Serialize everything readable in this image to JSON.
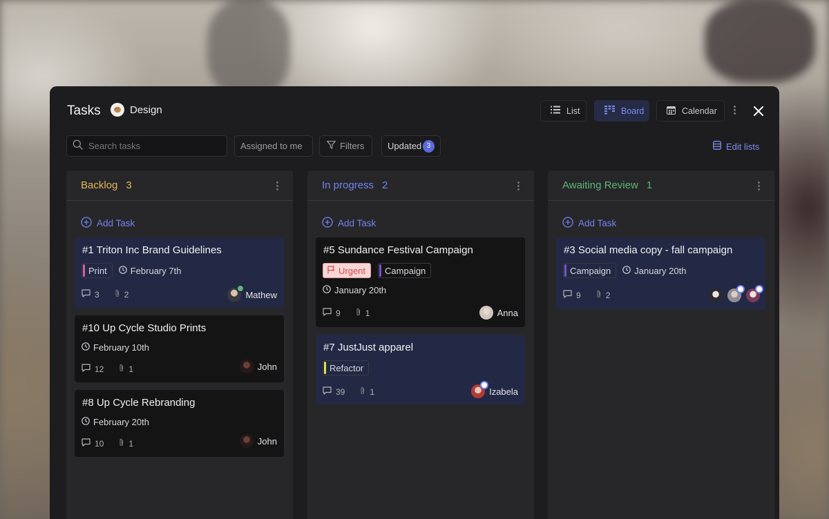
{
  "header": {
    "title": "Tasks",
    "project": "Design",
    "views": [
      {
        "label": "List",
        "icon": "list-icon"
      },
      {
        "label": "Board",
        "icon": "board-icon"
      },
      {
        "label": "Calendar",
        "icon": "calendar-icon"
      }
    ],
    "active_view": "Board"
  },
  "toolbar": {
    "search_placeholder": "Search tasks",
    "assigned_label": "Assigned to me",
    "filters_label": "Filters",
    "updated_label": "Updated",
    "updated_count": "3",
    "edit_lists_label": "Edit lists"
  },
  "colors": {
    "backlog": "#e6b65a",
    "in_progress": "#7383ee",
    "awaiting_review": "#5fb57b",
    "accent": "#7383ee"
  },
  "columns": [
    {
      "name": "Backlog",
      "count": "3",
      "add_label": "Add Task",
      "cards": [
        {
          "title": "#1  Triton Inc Brand Guidelines",
          "tag": "Print",
          "date": "February 7th",
          "comments": "3",
          "attachments": "2",
          "assignee": "Mathew"
        },
        {
          "title": "#10  Up Cycle Studio Prints",
          "date": "February 10th",
          "comments": "12",
          "attachments": "1",
          "assignee": "John"
        },
        {
          "title": "#8  Up Cycle Rebranding",
          "date": "February 20th",
          "comments": "10",
          "attachments": "1",
          "assignee": "John"
        }
      ]
    },
    {
      "name": "In progress",
      "count": "2",
      "add_label": "Add Task",
      "cards": [
        {
          "title": "#5  Sundance Festival Campaign",
          "priority": "Urgent",
          "tag": "Campaign",
          "date": "January 20th",
          "comments": "9",
          "attachments": "1",
          "assignee": "Anna"
        },
        {
          "title": "#7  JustJust apparel",
          "tag": "Refactor",
          "comments": "39",
          "attachments": "1",
          "assignee": "Izabela"
        }
      ]
    },
    {
      "name": "Awaiting Review",
      "count": "1",
      "add_label": "Add Task",
      "cards": [
        {
          "title": "#3  Social media copy - fall campaign",
          "tag": "Campaign",
          "date": "January 20th",
          "comments": "9",
          "attachments": "2"
        }
      ]
    }
  ]
}
